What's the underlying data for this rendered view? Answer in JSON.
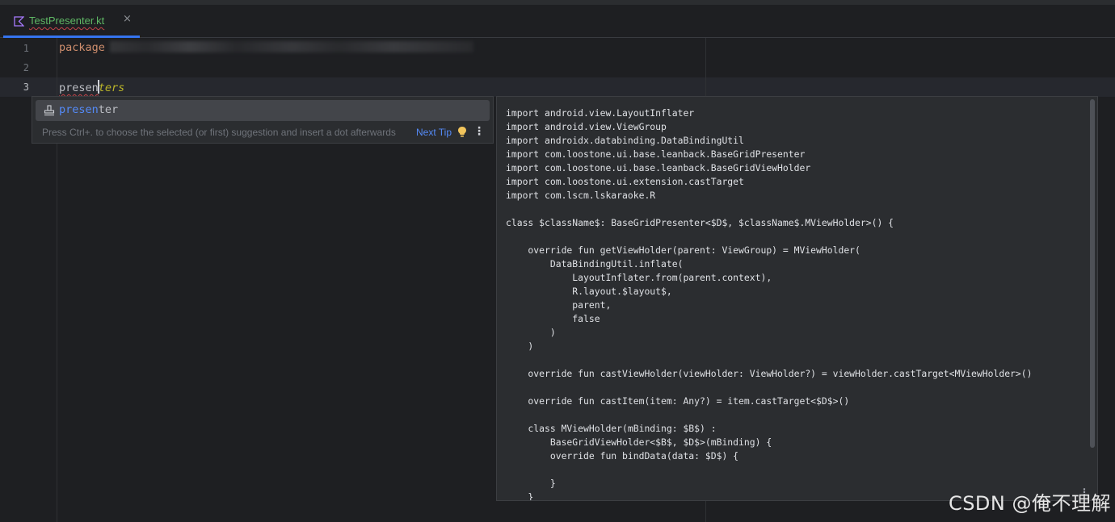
{
  "tab": {
    "file_name": "TestPresenter.kt",
    "close_glyph": "×",
    "icon": "kotlin-file-icon"
  },
  "editor": {
    "line_numbers": [
      "1",
      "2",
      "3"
    ],
    "line1_keyword": "package",
    "line3_typed": "presen",
    "line3_typed_after_caret": "ter",
    "line3_ghost": "s"
  },
  "completion": {
    "item_icon": "live-template-icon",
    "item_match": "presen",
    "item_rest": "ter",
    "hint": "Press Ctrl+. to choose the selected (or first) suggestion and insert a dot afterwards",
    "next_tip": "Next Tip",
    "bulb_icon": "lightbulb-icon",
    "more_icon": "more-vertical-icon"
  },
  "template_preview": {
    "code": "import android.view.LayoutInflater\nimport android.view.ViewGroup\nimport androidx.databinding.DataBindingUtil\nimport com.loostone.ui.base.leanback.BaseGridPresenter\nimport com.loostone.ui.base.leanback.BaseGridViewHolder\nimport com.loostone.ui.extension.castTarget\nimport com.lscm.lskaraoke.R\n\nclass $className$: BaseGridPresenter<$D$, $className$.MViewHolder>() {\n\n    override fun getViewHolder(parent: ViewGroup) = MViewHolder(\n        DataBindingUtil.inflate(\n            LayoutInflater.from(parent.context),\n            R.layout.$layout$,\n            parent,\n            false\n        )\n    )\n\n    override fun castViewHolder(viewHolder: ViewHolder?) = viewHolder.castTarget<MViewHolder>()\n\n    override fun castItem(item: Any?) = item.castTarget<$D$>()\n\n    class MViewHolder(mBinding: $B$) :\n        BaseGridViewHolder<$B$, $D$>(mBinding) {\n        override fun bindData(data: $D$) {\n\n        }\n    }\n}"
  },
  "watermark": "CSDN @俺不理解",
  "colors": {
    "background": "#1e1f22",
    "popup": "#2b2d30",
    "accent": "#3574f0",
    "match": "#548af7",
    "keyword": "#cf8e6d",
    "tab_text": "#5fb865"
  }
}
